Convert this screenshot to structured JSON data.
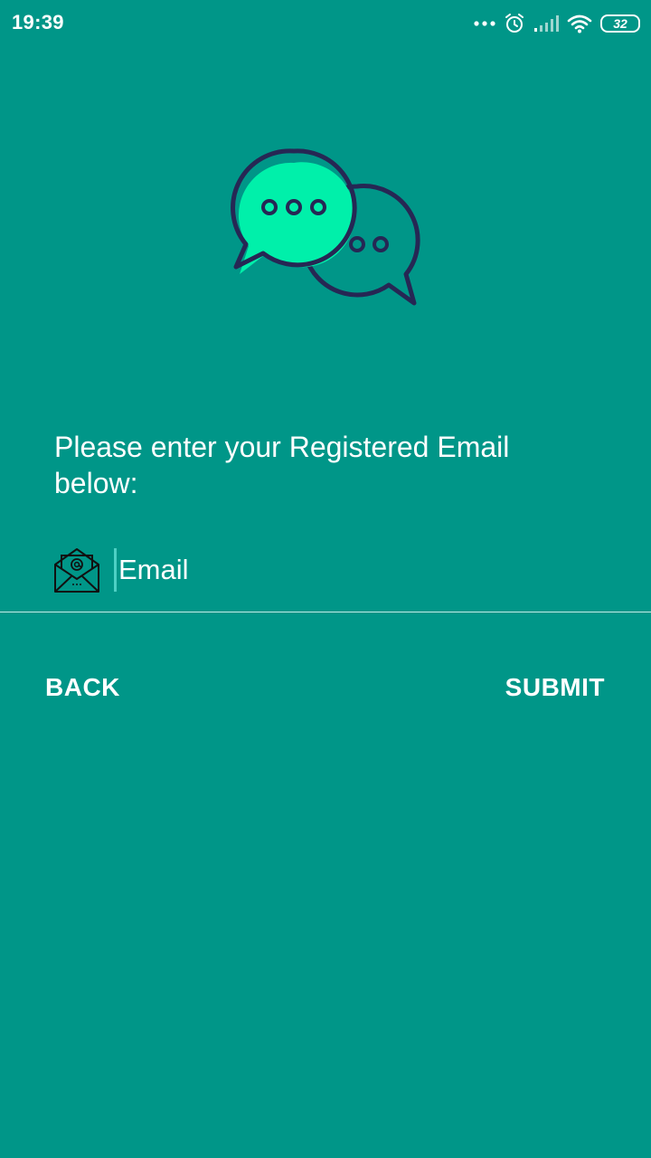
{
  "status_bar": {
    "time": "19:39",
    "battery_level": "32",
    "icons": [
      "more-dots-icon",
      "alarm-icon",
      "signal-icon",
      "wifi-icon",
      "battery-icon"
    ]
  },
  "hero": {
    "icon": "chat-bubbles-icon",
    "colors": {
      "accent": "#00f0aa",
      "outline": "#262754"
    }
  },
  "form": {
    "instruction": "Please enter your Registered Email below:",
    "email_placeholder": "Email",
    "email_value": "",
    "email_icon": "email-envelope-icon"
  },
  "actions": {
    "back_label": "BACK",
    "submit_label": "SUBMIT"
  },
  "colors": {
    "background": "#009688",
    "text": "#ffffff",
    "cursor": "#4dd0c4"
  }
}
